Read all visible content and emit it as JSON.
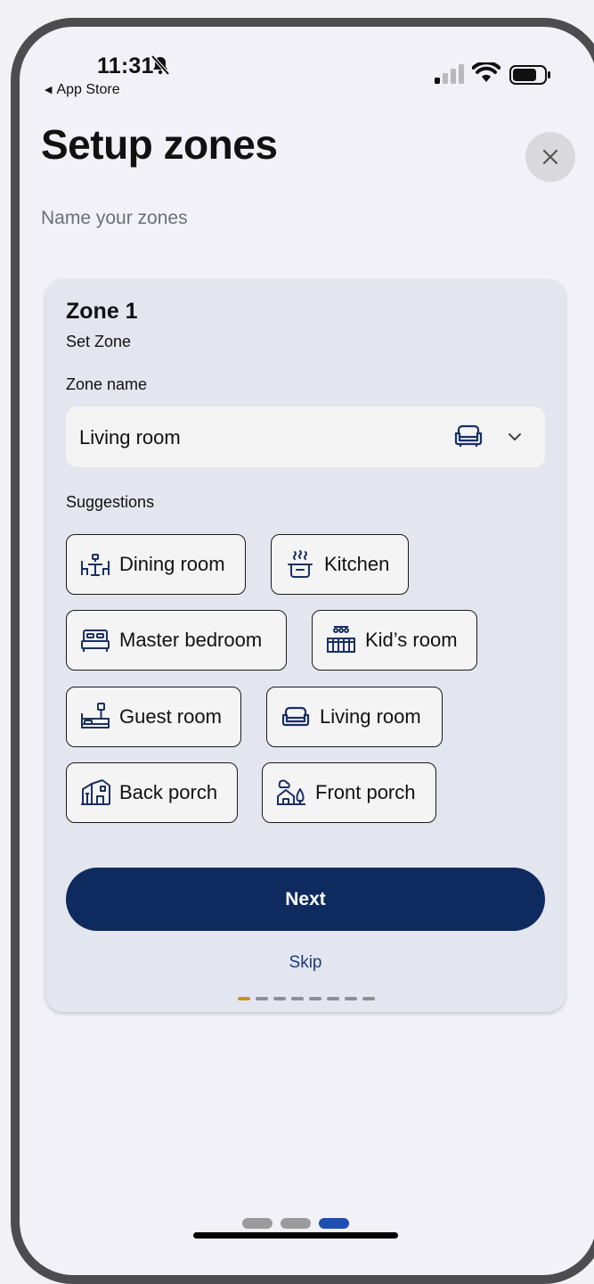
{
  "status_bar": {
    "time": "11:31",
    "back_app": "App Store"
  },
  "header": {
    "title": "Setup zones",
    "subtitle": "Name your zones"
  },
  "zone_card": {
    "zone_title": "Zone 1",
    "zone_subtitle": "Set Zone",
    "zone_name_label": "Zone name",
    "zone_name_value": "Living room",
    "zone_name_icon": "sofa-icon",
    "suggestions_label": "Suggestions",
    "suggestions": [
      {
        "label": "Dining room",
        "icon": "dining-table-icon"
      },
      {
        "label": "Kitchen",
        "icon": "cooking-pot-icon"
      },
      {
        "label": "Master bedroom",
        "icon": "bed-icon"
      },
      {
        "label": "Kid’s room",
        "icon": "crib-icon"
      },
      {
        "label": "Guest room",
        "icon": "guest-bed-lamp-icon"
      },
      {
        "label": "Living room",
        "icon": "sofa-icon"
      },
      {
        "label": "Back porch",
        "icon": "house-porch-icon"
      },
      {
        "label": "Front porch",
        "icon": "house-tree-icon"
      }
    ],
    "next_label": "Next",
    "skip_label": "Skip",
    "pager": {
      "total": 8,
      "active": 1
    }
  },
  "bottom_indicator": {
    "dots": 3,
    "active": 3
  },
  "colors": {
    "primary_button": "#0f2a5f",
    "card_background": "#e3e6ee",
    "page_background": "#f1f1f7",
    "pager_active": "#c9921e",
    "bottom_dot_active": "#1f4fb5",
    "skip_text": "#1c3c7a"
  }
}
